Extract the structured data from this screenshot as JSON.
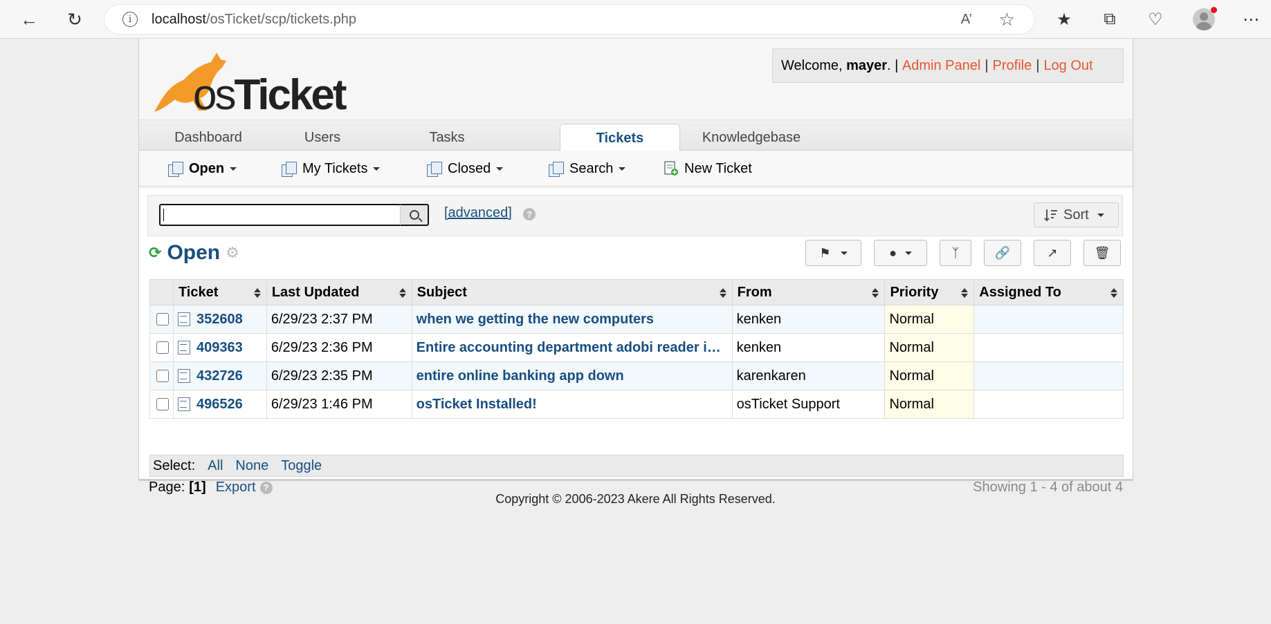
{
  "browser": {
    "url_host": "localhost",
    "url_path": "/osTicket/scp/tickets.php"
  },
  "header": {
    "logo_prefix": "os",
    "logo_suffix": "Ticket",
    "welcome_prefix": "Welcome,",
    "username": "mayer",
    "username_suffix": ". |",
    "admin_panel": "Admin Panel",
    "profile": "Profile",
    "logout": "Log Out"
  },
  "tabs": {
    "dashboard": "Dashboard",
    "users": "Users",
    "tasks": "Tasks",
    "tickets": "Tickets",
    "knowledgebase": "Knowledgebase"
  },
  "subnav": {
    "open": "Open",
    "my_tickets": "My Tickets",
    "closed": "Closed",
    "search": "Search",
    "new_ticket": "New Ticket"
  },
  "search": {
    "value": "",
    "advanced": "[advanced]",
    "sort": "Sort"
  },
  "queue": {
    "title": "Open"
  },
  "table": {
    "headers": [
      "Ticket",
      "Last Updated",
      "Subject",
      "From",
      "Priority",
      "Assigned To"
    ],
    "rows": [
      {
        "ticket": "352608",
        "updated": "6/29/23 2:37 PM",
        "subject": "when we getting the new computers",
        "from": "kenken",
        "priority": "Normal",
        "assigned": ""
      },
      {
        "ticket": "409363",
        "updated": "6/29/23 2:36 PM",
        "subject": "Entire accounting department adobi reader is down",
        "from": "kenken",
        "priority": "Normal",
        "assigned": ""
      },
      {
        "ticket": "432726",
        "updated": "6/29/23 2:35 PM",
        "subject": "entire online banking app down",
        "from": "karenkaren",
        "priority": "Normal",
        "assigned": ""
      },
      {
        "ticket": "496526",
        "updated": "6/29/23 1:46 PM",
        "subject": "osTicket Installed!",
        "from": "osTicket Support",
        "priority": "Normal",
        "assigned": ""
      }
    ]
  },
  "select": {
    "label": "Select:",
    "all": "All",
    "none": "None",
    "toggle": "Toggle"
  },
  "pager": {
    "label": "Page:",
    "current": "[1]",
    "export": "Export",
    "showing": "Showing 1 - 4 of about 4"
  },
  "footer": {
    "copyright": "Copyright © 2006-2023 Akere All Rights Reserved."
  },
  "colors": {
    "link_blue": "#184e81",
    "header_link_orange": "#e5572e",
    "refresh_green": "#2aa033"
  }
}
